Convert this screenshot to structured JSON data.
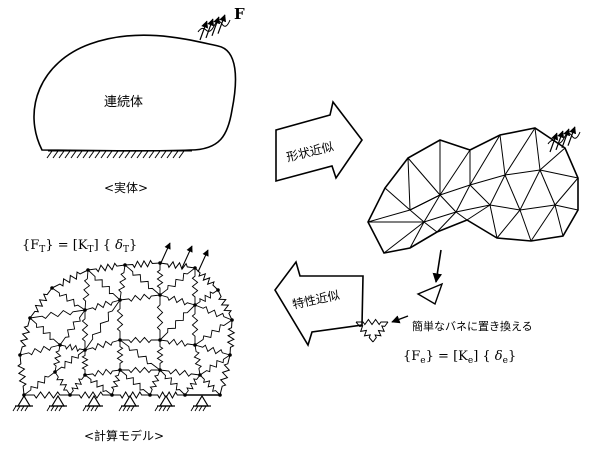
{
  "continuum": {
    "label": "連続体",
    "caption": "<実体>",
    "force_label": "F"
  },
  "arrows": {
    "shape_approx": "形状近似",
    "property_approx": "特性近似"
  },
  "mesh": {
    "note": "簡単なバネに置き換える",
    "element_eq": {
      "f": "{F",
      "f_sub": "e",
      "f_close": "}",
      "eq": " = [K",
      "k_sub": "e",
      "k_close": "]",
      "d_open": " {",
      "d": " δ",
      "d_sub": "e",
      "d_close": "}"
    }
  },
  "spring_model": {
    "caption": "<計算モデル>",
    "global_eq": {
      "f": "{F",
      "f_sub": "T",
      "f_close": "}",
      "eq": " = [K",
      "k_sub": "T",
      "k_close": "]",
      "d_open": " {",
      "d": " δ",
      "d_sub": "T",
      "d_close": "}"
    }
  }
}
